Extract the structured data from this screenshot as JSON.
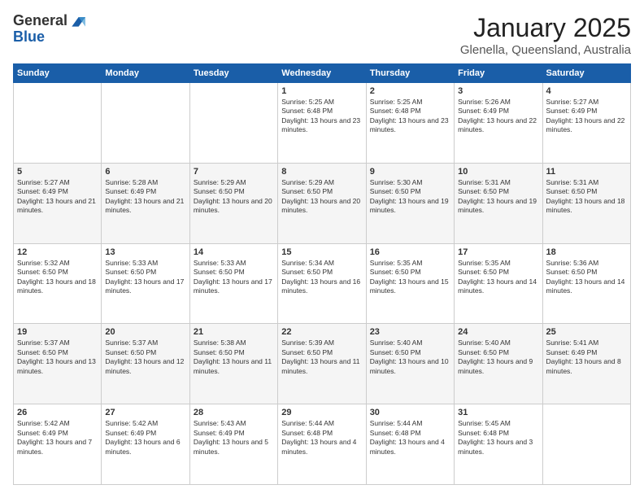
{
  "app": {
    "logo_line1": "General",
    "logo_line2": "Blue"
  },
  "header": {
    "month": "January 2025",
    "location": "Glenella, Queensland, Australia"
  },
  "weekdays": [
    "Sunday",
    "Monday",
    "Tuesday",
    "Wednesday",
    "Thursday",
    "Friday",
    "Saturday"
  ],
  "weeks": [
    [
      {
        "day": "",
        "text": ""
      },
      {
        "day": "",
        "text": ""
      },
      {
        "day": "",
        "text": ""
      },
      {
        "day": "1",
        "text": "Sunrise: 5:25 AM\nSunset: 6:48 PM\nDaylight: 13 hours and 23 minutes."
      },
      {
        "day": "2",
        "text": "Sunrise: 5:25 AM\nSunset: 6:48 PM\nDaylight: 13 hours and 23 minutes."
      },
      {
        "day": "3",
        "text": "Sunrise: 5:26 AM\nSunset: 6:49 PM\nDaylight: 13 hours and 22 minutes."
      },
      {
        "day": "4",
        "text": "Sunrise: 5:27 AM\nSunset: 6:49 PM\nDaylight: 13 hours and 22 minutes."
      }
    ],
    [
      {
        "day": "5",
        "text": "Sunrise: 5:27 AM\nSunset: 6:49 PM\nDaylight: 13 hours and 21 minutes."
      },
      {
        "day": "6",
        "text": "Sunrise: 5:28 AM\nSunset: 6:49 PM\nDaylight: 13 hours and 21 minutes."
      },
      {
        "day": "7",
        "text": "Sunrise: 5:29 AM\nSunset: 6:50 PM\nDaylight: 13 hours and 20 minutes."
      },
      {
        "day": "8",
        "text": "Sunrise: 5:29 AM\nSunset: 6:50 PM\nDaylight: 13 hours and 20 minutes."
      },
      {
        "day": "9",
        "text": "Sunrise: 5:30 AM\nSunset: 6:50 PM\nDaylight: 13 hours and 19 minutes."
      },
      {
        "day": "10",
        "text": "Sunrise: 5:31 AM\nSunset: 6:50 PM\nDaylight: 13 hours and 19 minutes."
      },
      {
        "day": "11",
        "text": "Sunrise: 5:31 AM\nSunset: 6:50 PM\nDaylight: 13 hours and 18 minutes."
      }
    ],
    [
      {
        "day": "12",
        "text": "Sunrise: 5:32 AM\nSunset: 6:50 PM\nDaylight: 13 hours and 18 minutes."
      },
      {
        "day": "13",
        "text": "Sunrise: 5:33 AM\nSunset: 6:50 PM\nDaylight: 13 hours and 17 minutes."
      },
      {
        "day": "14",
        "text": "Sunrise: 5:33 AM\nSunset: 6:50 PM\nDaylight: 13 hours and 17 minutes."
      },
      {
        "day": "15",
        "text": "Sunrise: 5:34 AM\nSunset: 6:50 PM\nDaylight: 13 hours and 16 minutes."
      },
      {
        "day": "16",
        "text": "Sunrise: 5:35 AM\nSunset: 6:50 PM\nDaylight: 13 hours and 15 minutes."
      },
      {
        "day": "17",
        "text": "Sunrise: 5:35 AM\nSunset: 6:50 PM\nDaylight: 13 hours and 14 minutes."
      },
      {
        "day": "18",
        "text": "Sunrise: 5:36 AM\nSunset: 6:50 PM\nDaylight: 13 hours and 14 minutes."
      }
    ],
    [
      {
        "day": "19",
        "text": "Sunrise: 5:37 AM\nSunset: 6:50 PM\nDaylight: 13 hours and 13 minutes."
      },
      {
        "day": "20",
        "text": "Sunrise: 5:37 AM\nSunset: 6:50 PM\nDaylight: 13 hours and 12 minutes."
      },
      {
        "day": "21",
        "text": "Sunrise: 5:38 AM\nSunset: 6:50 PM\nDaylight: 13 hours and 11 minutes."
      },
      {
        "day": "22",
        "text": "Sunrise: 5:39 AM\nSunset: 6:50 PM\nDaylight: 13 hours and 11 minutes."
      },
      {
        "day": "23",
        "text": "Sunrise: 5:40 AM\nSunset: 6:50 PM\nDaylight: 13 hours and 10 minutes."
      },
      {
        "day": "24",
        "text": "Sunrise: 5:40 AM\nSunset: 6:50 PM\nDaylight: 13 hours and 9 minutes."
      },
      {
        "day": "25",
        "text": "Sunrise: 5:41 AM\nSunset: 6:49 PM\nDaylight: 13 hours and 8 minutes."
      }
    ],
    [
      {
        "day": "26",
        "text": "Sunrise: 5:42 AM\nSunset: 6:49 PM\nDaylight: 13 hours and 7 minutes."
      },
      {
        "day": "27",
        "text": "Sunrise: 5:42 AM\nSunset: 6:49 PM\nDaylight: 13 hours and 6 minutes."
      },
      {
        "day": "28",
        "text": "Sunrise: 5:43 AM\nSunset: 6:49 PM\nDaylight: 13 hours and 5 minutes."
      },
      {
        "day": "29",
        "text": "Sunrise: 5:44 AM\nSunset: 6:48 PM\nDaylight: 13 hours and 4 minutes."
      },
      {
        "day": "30",
        "text": "Sunrise: 5:44 AM\nSunset: 6:48 PM\nDaylight: 13 hours and 4 minutes."
      },
      {
        "day": "31",
        "text": "Sunrise: 5:45 AM\nSunset: 6:48 PM\nDaylight: 13 hours and 3 minutes."
      },
      {
        "day": "",
        "text": ""
      }
    ]
  ]
}
